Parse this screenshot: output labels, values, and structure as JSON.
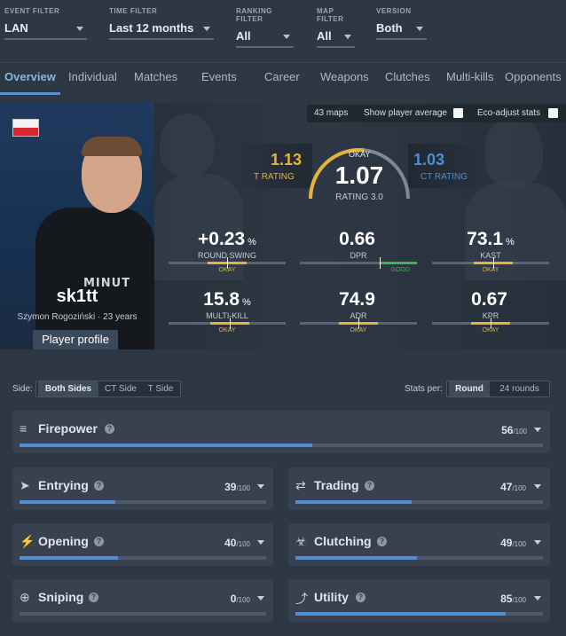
{
  "filters": [
    {
      "label": "EVENT FILTER",
      "value": "LAN"
    },
    {
      "label": "TIME FILTER",
      "value": "Last 12 months"
    },
    {
      "label": "RANKING FILTER",
      "value": "All"
    },
    {
      "label": "MAP FILTER",
      "value": "All"
    },
    {
      "label": "VERSION",
      "value": "Both"
    }
  ],
  "tabs": [
    "Overview",
    "Individual",
    "Matches",
    "Events",
    "Career",
    "Weapons",
    "Clutches",
    "Multi-kills",
    "Opponents"
  ],
  "active_tab": "Overview",
  "hero": {
    "maps": "43 maps",
    "show_average": "Show player average",
    "eco_adjust": "Eco-adjust stats",
    "player": {
      "nick": "sk1tt",
      "real_name": "Szymon Rogoziński · 23 years",
      "profile_button": "Player profile",
      "shirt_text": "MINUT"
    },
    "t_rating": {
      "value": "1.13",
      "label": "T RATING"
    },
    "ct_rating": {
      "value": "1.03",
      "label": "CT RATING"
    },
    "rating": {
      "value": "1.07",
      "label": "RATING 3.0",
      "verdict": "OKAY",
      "gauge_fraction": 0.53
    },
    "stats": [
      {
        "value": "+0.23",
        "unit": "%",
        "label": "ROUND SWING",
        "verdict": "OKAY",
        "marker": 0.5
      },
      {
        "value": "0.66",
        "unit": "",
        "label": "DPR",
        "verdict": "GOOD",
        "marker": 0.68
      },
      {
        "value": "73.1",
        "unit": "%",
        "label": "KAST",
        "verdict": "OKAY",
        "marker": 0.52
      },
      {
        "value": "15.8",
        "unit": "%",
        "label": "MULTI-KILL",
        "verdict": "OKAY",
        "marker": 0.52
      },
      {
        "value": "74.9",
        "unit": "",
        "label": "ADR",
        "verdict": "OKAY",
        "marker": 0.5
      },
      {
        "value": "0.67",
        "unit": "",
        "label": "KPR",
        "verdict": "OKAY",
        "marker": 0.5
      }
    ]
  },
  "controls": {
    "side_label": "Side:",
    "side_options": [
      "Both Sides",
      "CT Side",
      "T Side"
    ],
    "stats_per_label": "Stats per:",
    "per_options": [
      "Round",
      "24 rounds"
    ]
  },
  "colors": {
    "t": "#e8b23a",
    "ct": "#4d8fd6",
    "good": "#3cb54a",
    "okay": "#e8b23a",
    "accent": "#4e8fd8"
  },
  "cards": [
    {
      "title": "Firepower",
      "score": "56",
      "max": "/100",
      "icon": "firepower-icon",
      "level": 0.56
    },
    {
      "title": "Entrying",
      "score": "39",
      "max": "/100",
      "icon": "entrying-icon",
      "level": 0.39
    },
    {
      "title": "Trading",
      "score": "47",
      "max": "/100",
      "icon": "trading-icon",
      "level": 0.47
    },
    {
      "title": "Opening",
      "score": "40",
      "max": "/100",
      "icon": "opening-icon",
      "level": 0.4
    },
    {
      "title": "Clutching",
      "score": "49",
      "max": "/100",
      "icon": "clutching-icon",
      "level": 0.49
    },
    {
      "title": "Sniping",
      "score": "0",
      "max": "/100",
      "icon": "sniping-icon",
      "level": 0.0
    },
    {
      "title": "Utility",
      "score": "85",
      "max": "/100",
      "icon": "utility-icon",
      "level": 0.85
    }
  ]
}
